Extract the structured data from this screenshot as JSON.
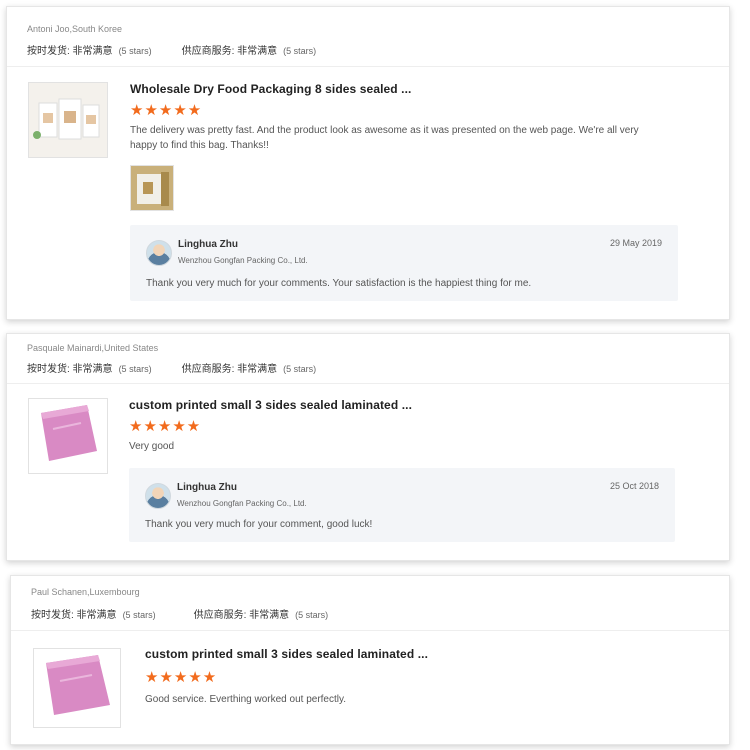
{
  "reviews": [
    {
      "reviewer": "Antoni Joo,South Koree",
      "shipping_label": "按时发货: 非常满意",
      "shipping_stars": "(5 stars)",
      "service_label": "供应商服务: 非常满意",
      "service_stars": "(5 stars)",
      "product_title": "Wholesale Dry Food Packaging 8 sides sealed ...",
      "stars": "★★★★★",
      "rating": 5,
      "comment": "The delivery was pretty fast. And the product look as awesome as it was presented on the web page. We're all very happy to find this bag. Thanks!!",
      "reply": {
        "name": "Linghua Zhu",
        "company": "Wenzhou Gongfan Packing Co., Ltd.",
        "date": "29 May 2019",
        "text": "Thank you very much for your comments. Your satisfaction is the happiest thing for me."
      }
    },
    {
      "reviewer": "Pasquale Mainardi,United States",
      "shipping_label": "按时发货: 非常满意",
      "shipping_stars": "(5 stars)",
      "service_label": "供应商服务: 非常满意",
      "service_stars": "(5 stars)",
      "product_title": "custom printed small 3 sides sealed laminated ...",
      "stars": "★★★★★",
      "rating": 5,
      "comment": "Very good",
      "reply": {
        "name": "Linghua Zhu",
        "company": "Wenzhou Gongfan Packing Co., Ltd.",
        "date": "25 Oct 2018",
        "text": "Thank you very much for your comment, good luck!"
      }
    },
    {
      "reviewer": "Paul Schanen,Luxembourg",
      "shipping_label": "按时发货: 非常满意",
      "shipping_stars": "(5 stars)",
      "service_label": "供应商服务: 非常满意",
      "service_stars": "(5 stars)",
      "product_title": "custom printed small 3 sides sealed laminated ...",
      "stars": "★★★★★",
      "rating": 5,
      "comment": "Good service. Everthing worked out perfectly."
    }
  ],
  "colors": {
    "star": "#f26b1d",
    "reply_bg": "#f3f5f8",
    "bag_pink": "#d98ac4"
  }
}
